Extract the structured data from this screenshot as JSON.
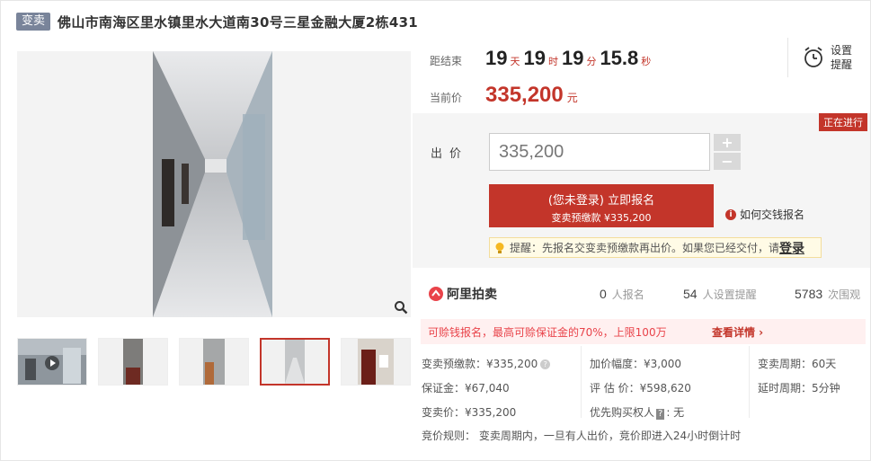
{
  "header": {
    "tag": "变卖",
    "title": "佛山市南海区里水镇里水大道南30号三星金融大厦2栋431"
  },
  "countdown": {
    "label": "距结束",
    "days": "19",
    "days_unit": "天",
    "hours": "19",
    "hours_unit": "时",
    "minutes": "19",
    "minutes_unit": "分",
    "seconds": "15.8",
    "seconds_unit": "秒"
  },
  "current_price": {
    "label": "当前价",
    "value": "335,200",
    "unit": "元"
  },
  "remind": {
    "label": "设置提醒",
    "icon": "alarm-clock-icon"
  },
  "bid": {
    "status": "正在进行",
    "label": "出价",
    "input_value": "335,200",
    "plus": "+",
    "minus": "−",
    "signup_line1": "(您未登录) 立即报名",
    "signup_line2": "变卖预缴款 ¥335,200",
    "howto": "如何交钱报名",
    "tip_text": "提醒：先报名交变卖预缴款再出价。如果您已经交付，请",
    "tip_login": "登录"
  },
  "stats": {
    "brand": "阿里拍卖",
    "signups": "0",
    "signups_unit": "人报名",
    "reminders": "54",
    "reminders_unit": "人设置提醒",
    "views": "5783",
    "views_unit": "次围观"
  },
  "deposit_promo": {
    "text": "可赊钱报名，最高可赊保证金的70%，上限100万",
    "more": "查看详情 ›"
  },
  "details": {
    "prepay": "变卖预缴款：¥335,200",
    "increment": "加价幅度：¥3,000",
    "period": "变卖周期：60天",
    "deposit": "保证金：¥67,040",
    "appraisal": "评 估 价：¥598,620",
    "extension": "延时周期：5分钟",
    "sale_price": "变卖价：¥335,200",
    "priority_label": "优先购买权人",
    "priority_badge": "?",
    "priority_value": ": 无",
    "rules": "竞价规则：  变卖周期内，一旦有人出价，竞价即进入24小时倒计时"
  }
}
